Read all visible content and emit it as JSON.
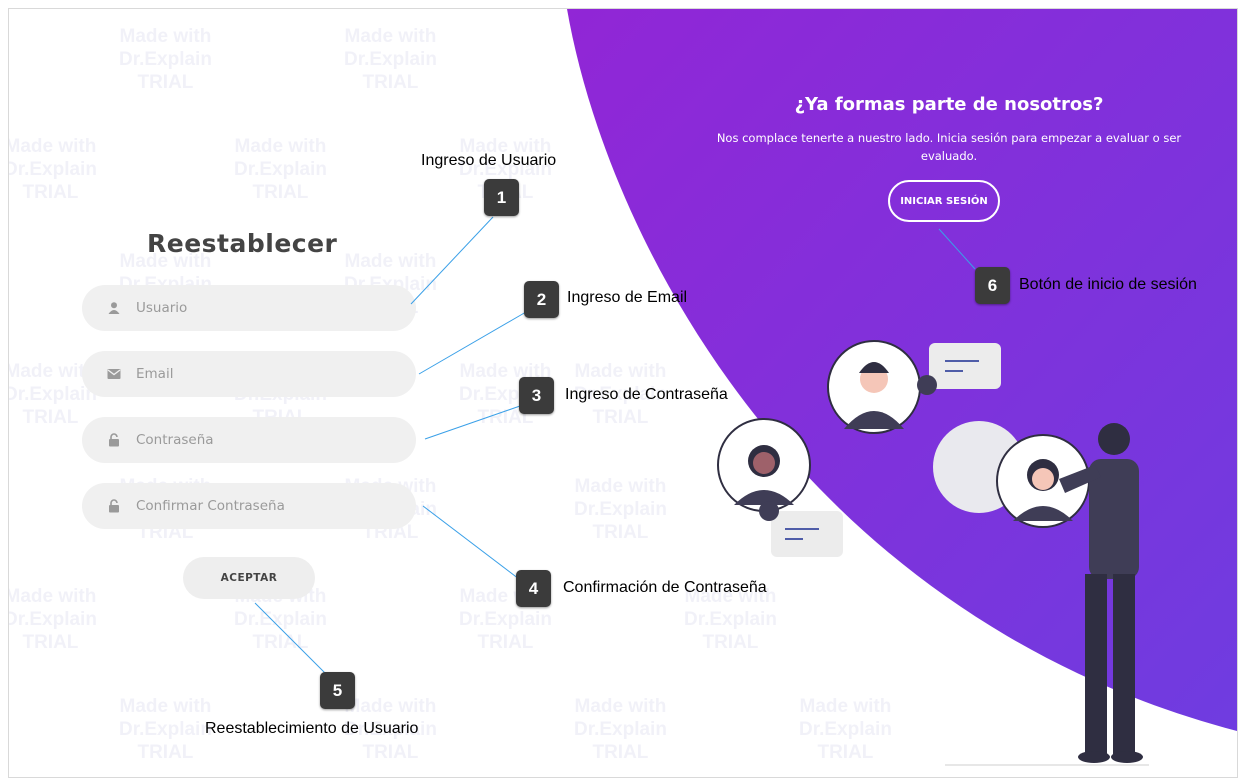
{
  "watermark_text": "Made with\nDr.Explain\nTRIAL",
  "hero": {
    "title": "¿Ya formas parte de nosotros?",
    "text": "Nos complace tenerte a nuestro lado. Inicia sesión para empezar a evaluar o ser evaluado.",
    "login_button": "INICIAR SESIÓN"
  },
  "form": {
    "title": "Reestablecer",
    "fields": [
      {
        "label": "Usuario",
        "icon": "user-icon"
      },
      {
        "label": "Email",
        "icon": "envelope-icon"
      },
      {
        "label": "Contraseña",
        "icon": "lock-icon"
      },
      {
        "label": "Confirmar Contraseña",
        "icon": "lock-icon"
      }
    ],
    "accept_button": "ACEPTAR"
  },
  "callouts": [
    {
      "number": "1",
      "label": "Ingreso de Usuario"
    },
    {
      "number": "2",
      "label": "Ingreso de Email"
    },
    {
      "number": "3",
      "label": "Ingreso de Contraseña"
    },
    {
      "number": "4",
      "label": "Confirmación de Contraseña"
    },
    {
      "number": "5",
      "label": "Reestablecimiento de Usuario"
    },
    {
      "number": "6",
      "label": "Botón de inicio de sesión"
    }
  ],
  "colors": {
    "purple_start": "#8a2be2",
    "purple_end": "#7a3fe0",
    "field_bg": "#f0f0f0",
    "callout_bg": "#3b3b3b",
    "line": "#3aa0e8"
  }
}
